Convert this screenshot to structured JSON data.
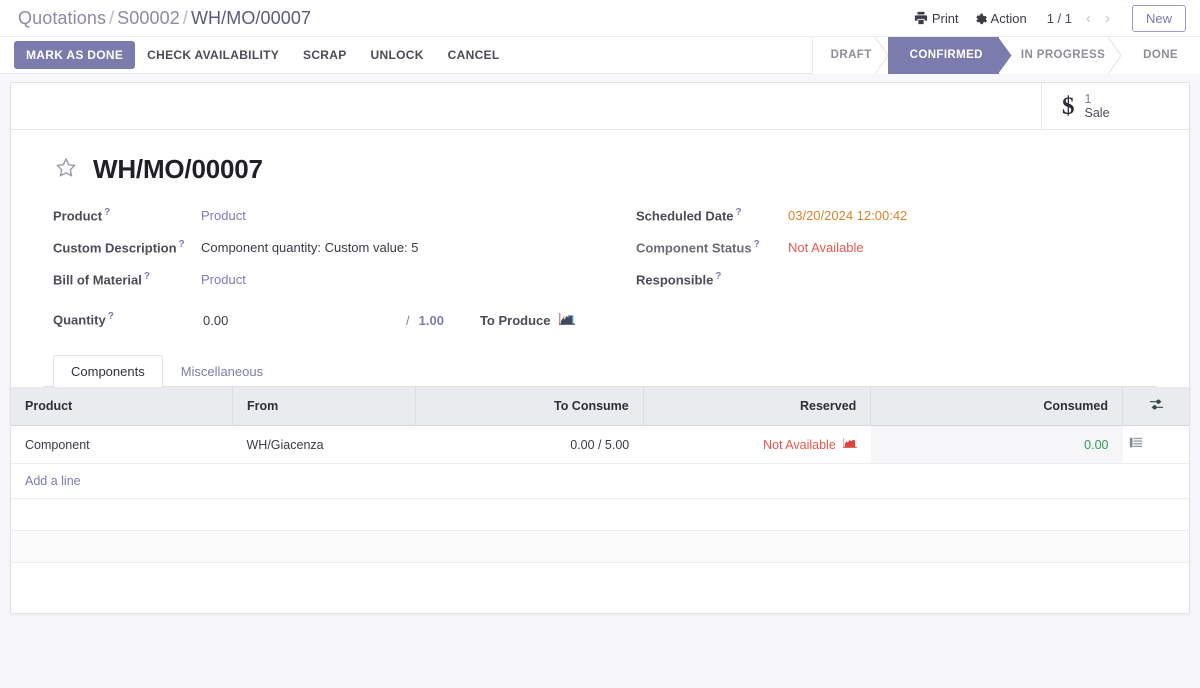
{
  "breadcrumb": {
    "items": [
      "Quotations",
      "S00002",
      "WH/MO/00007"
    ],
    "separator": "/"
  },
  "control_panel": {
    "print_label": "Print",
    "print_icon": "printer-icon",
    "action_label": "Action",
    "action_icon": "gear-icon",
    "pager_value": "1 / 1",
    "prev_icon": "chevron-left-icon",
    "next_icon": "chevron-right-icon",
    "new_label": "New"
  },
  "action_bar": {
    "primary": "MARK AS DONE",
    "buttons": [
      "CHECK AVAILABILITY",
      "SCRAP",
      "UNLOCK",
      "CANCEL"
    ]
  },
  "statusbar": {
    "stages": [
      "DRAFT",
      "CONFIRMED",
      "IN PROGRESS",
      "DONE"
    ],
    "active": "CONFIRMED",
    "active_color": "#7c7bad"
  },
  "smart_button": {
    "icon": "dollar-icon",
    "value": "1",
    "label": "Sale"
  },
  "record": {
    "favorite_icon": "star-icon",
    "title": "WH/MO/00007"
  },
  "fields_left": [
    {
      "label": "Product",
      "help": "?",
      "value": "Product",
      "style": "link"
    },
    {
      "label": "Custom Description",
      "help": "?",
      "value": "Component quantity: Custom value: 5",
      "style": "text"
    },
    {
      "label": "Bill of Material",
      "help": "?",
      "value": "Product",
      "style": "link"
    }
  ],
  "quantity": {
    "label": "Quantity",
    "help": "?",
    "value": "0.00",
    "separator": "/",
    "total": "1.00",
    "to_produce_label": "To Produce",
    "to_produce_icon": "forecast-chart-icon"
  },
  "fields_right": [
    {
      "label": "Scheduled Date",
      "help": "?",
      "value": "03/20/2024 12:00:42",
      "style": "warn"
    },
    {
      "label": "Component Status",
      "help": "?",
      "value": "Not Available",
      "style": "danger"
    },
    {
      "label": "Responsible",
      "help": "?",
      "value": "",
      "style": "text"
    }
  ],
  "notebook": {
    "tabs": [
      {
        "label": "Components",
        "active": true
      },
      {
        "label": "Miscellaneous",
        "active": false
      }
    ]
  },
  "components_list": {
    "columns": [
      "Product",
      "From",
      "To Consume",
      "Reserved",
      "Consumed"
    ],
    "optional_columns_icon": "sliders-icon",
    "rows": [
      {
        "product": "Component",
        "from": "WH/Giacenza",
        "to_consume": "0.00 / 5.00",
        "reserved": "Not Available",
        "reserved_icon": "forecast-chart-icon-red",
        "consumed": "0.00",
        "row_icon": "detailed-operations-icon"
      }
    ],
    "add_line_label": "Add a line"
  },
  "colors": {
    "primary": "#7c7bad",
    "danger": "#e8584f",
    "warning": "#d9822b",
    "success": "#2e9e50"
  }
}
